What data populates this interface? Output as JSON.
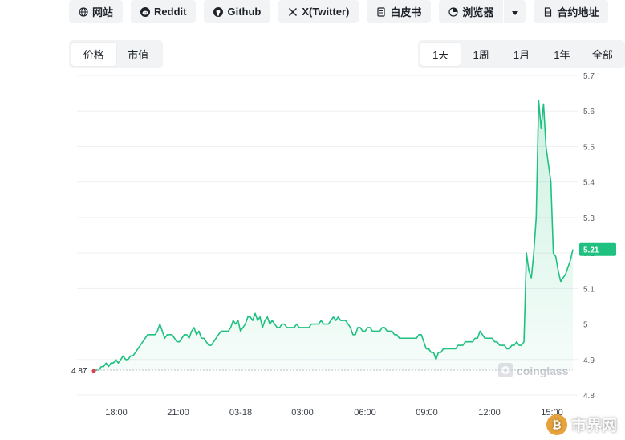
{
  "links": [
    {
      "label": "网站",
      "icon": "globe-icon"
    },
    {
      "label": "Reddit",
      "icon": "reddit-icon"
    },
    {
      "label": "Github",
      "icon": "github-icon"
    },
    {
      "label": "X(Twitter)",
      "icon": "x-icon"
    },
    {
      "label": "白皮书",
      "icon": "document-icon"
    },
    {
      "label": "浏览器",
      "icon": "explorer-icon"
    },
    {
      "label": "合约地址",
      "icon": "contract-icon"
    }
  ],
  "metric_tabs": {
    "options": [
      "价格",
      "市值"
    ],
    "active": 0
  },
  "range_tabs": {
    "options": [
      "1天",
      "1周",
      "1月",
      "1年",
      "全部"
    ],
    "active": 0
  },
  "chart_data": {
    "type": "area",
    "y_ticks": [
      "5.7",
      "5.6",
      "5.5",
      "5.4",
      "5.3",
      "5.2",
      "5.1",
      "5",
      "4.9",
      "4.8"
    ],
    "y_range": [
      4.8,
      5.7
    ],
    "x_ticks": [
      "18:00",
      "21:00",
      "03-18",
      "03:00",
      "06:00",
      "09:00",
      "12:00",
      "15:00"
    ],
    "start_label": "4.87",
    "last_label": "5.21",
    "watermark": "coinglass",
    "line_color": "#1ec180",
    "series": [
      {
        "values": [
          4.87,
          4.87,
          4.87,
          4.88,
          4.88,
          4.89,
          4.88,
          4.89,
          4.89,
          4.9,
          4.89,
          4.9,
          4.91,
          4.9,
          4.9,
          4.91,
          4.91,
          4.92,
          4.93,
          4.94,
          4.95,
          4.96,
          4.97,
          4.97,
          4.97,
          4.97,
          4.98,
          5.0,
          4.98,
          4.96,
          4.97,
          4.97,
          4.97,
          4.96,
          4.95,
          4.95,
          4.96,
          4.97,
          4.97,
          4.96,
          4.98,
          4.99,
          4.97,
          4.98,
          4.96,
          4.96,
          4.95,
          4.94,
          4.94,
          4.95,
          4.96,
          4.97,
          4.98,
          4.98,
          4.98,
          4.98,
          4.99,
          5.01,
          5.0,
          5.01,
          4.98,
          4.99,
          5.0,
          5.02,
          5.02,
          5.01,
          5.03,
          5.01,
          5.02,
          4.99,
          5.01,
          5.02,
          5.0,
          5.01,
          5.0,
          4.99,
          4.99,
          5.0,
          5.0,
          4.99,
          4.99,
          4.99,
          4.99,
          5.0,
          4.99,
          4.99,
          4.99,
          4.99,
          4.99,
          5.0,
          5.0,
          5.0,
          5.0,
          5.01,
          5.0,
          5.0,
          5.0,
          5.01,
          5.02,
          5.01,
          5.02,
          5.01,
          5.01,
          5.01,
          5.0,
          4.99,
          4.97,
          4.97,
          4.99,
          4.99,
          4.98,
          4.98,
          4.99,
          4.99,
          4.98,
          4.98,
          4.98,
          4.98,
          4.99,
          4.99,
          4.98,
          4.98,
          4.98,
          4.97,
          4.97,
          4.96,
          4.96,
          4.96,
          4.96,
          4.96,
          4.96,
          4.96,
          4.96,
          4.97,
          4.97,
          4.95,
          4.93,
          4.93,
          4.92,
          4.92,
          4.9,
          4.92,
          4.92,
          4.93,
          4.93,
          4.93,
          4.93,
          4.93,
          4.93,
          4.94,
          4.94,
          4.94,
          4.95,
          4.95,
          4.95,
          4.95,
          4.96,
          4.96,
          4.98,
          4.97,
          4.96,
          4.96,
          4.96,
          4.96,
          4.95,
          4.95,
          4.94,
          4.94,
          4.94,
          4.93,
          4.93,
          4.94,
          4.94,
          4.95,
          4.94,
          4.94,
          4.95,
          5.2,
          5.15,
          5.13,
          5.2,
          5.3,
          5.63,
          5.55,
          5.62,
          5.5,
          5.45,
          5.4,
          5.2,
          5.19,
          5.15,
          5.12,
          5.13,
          5.14,
          5.16,
          5.18,
          5.21
        ]
      }
    ]
  }
}
